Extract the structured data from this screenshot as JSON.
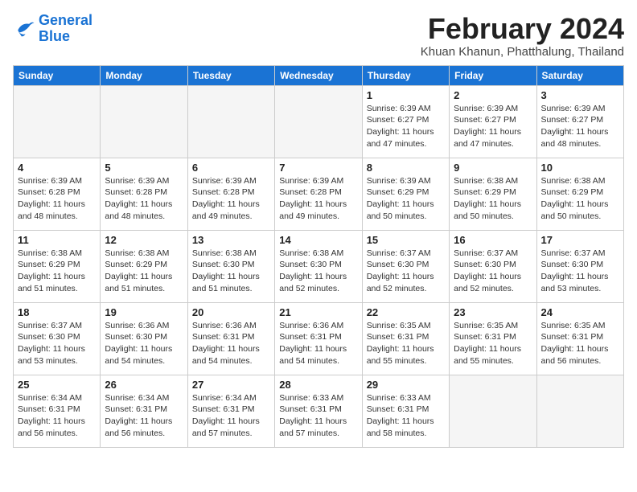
{
  "header": {
    "logo_line1": "General",
    "logo_line2": "Blue",
    "title": "February 2024",
    "subtitle": "Khuan Khanun, Phatthalung, Thailand"
  },
  "days_of_week": [
    "Sunday",
    "Monday",
    "Tuesday",
    "Wednesday",
    "Thursday",
    "Friday",
    "Saturday"
  ],
  "weeks": [
    [
      {
        "day": "",
        "info": ""
      },
      {
        "day": "",
        "info": ""
      },
      {
        "day": "",
        "info": ""
      },
      {
        "day": "",
        "info": ""
      },
      {
        "day": "1",
        "info": "Sunrise: 6:39 AM\nSunset: 6:27 PM\nDaylight: 11 hours\nand 47 minutes."
      },
      {
        "day": "2",
        "info": "Sunrise: 6:39 AM\nSunset: 6:27 PM\nDaylight: 11 hours\nand 47 minutes."
      },
      {
        "day": "3",
        "info": "Sunrise: 6:39 AM\nSunset: 6:27 PM\nDaylight: 11 hours\nand 48 minutes."
      }
    ],
    [
      {
        "day": "4",
        "info": "Sunrise: 6:39 AM\nSunset: 6:28 PM\nDaylight: 11 hours\nand 48 minutes."
      },
      {
        "day": "5",
        "info": "Sunrise: 6:39 AM\nSunset: 6:28 PM\nDaylight: 11 hours\nand 48 minutes."
      },
      {
        "day": "6",
        "info": "Sunrise: 6:39 AM\nSunset: 6:28 PM\nDaylight: 11 hours\nand 49 minutes."
      },
      {
        "day": "7",
        "info": "Sunrise: 6:39 AM\nSunset: 6:28 PM\nDaylight: 11 hours\nand 49 minutes."
      },
      {
        "day": "8",
        "info": "Sunrise: 6:39 AM\nSunset: 6:29 PM\nDaylight: 11 hours\nand 50 minutes."
      },
      {
        "day": "9",
        "info": "Sunrise: 6:38 AM\nSunset: 6:29 PM\nDaylight: 11 hours\nand 50 minutes."
      },
      {
        "day": "10",
        "info": "Sunrise: 6:38 AM\nSunset: 6:29 PM\nDaylight: 11 hours\nand 50 minutes."
      }
    ],
    [
      {
        "day": "11",
        "info": "Sunrise: 6:38 AM\nSunset: 6:29 PM\nDaylight: 11 hours\nand 51 minutes."
      },
      {
        "day": "12",
        "info": "Sunrise: 6:38 AM\nSunset: 6:29 PM\nDaylight: 11 hours\nand 51 minutes."
      },
      {
        "day": "13",
        "info": "Sunrise: 6:38 AM\nSunset: 6:30 PM\nDaylight: 11 hours\nand 51 minutes."
      },
      {
        "day": "14",
        "info": "Sunrise: 6:38 AM\nSunset: 6:30 PM\nDaylight: 11 hours\nand 52 minutes."
      },
      {
        "day": "15",
        "info": "Sunrise: 6:37 AM\nSunset: 6:30 PM\nDaylight: 11 hours\nand 52 minutes."
      },
      {
        "day": "16",
        "info": "Sunrise: 6:37 AM\nSunset: 6:30 PM\nDaylight: 11 hours\nand 52 minutes."
      },
      {
        "day": "17",
        "info": "Sunrise: 6:37 AM\nSunset: 6:30 PM\nDaylight: 11 hours\nand 53 minutes."
      }
    ],
    [
      {
        "day": "18",
        "info": "Sunrise: 6:37 AM\nSunset: 6:30 PM\nDaylight: 11 hours\nand 53 minutes."
      },
      {
        "day": "19",
        "info": "Sunrise: 6:36 AM\nSunset: 6:30 PM\nDaylight: 11 hours\nand 54 minutes."
      },
      {
        "day": "20",
        "info": "Sunrise: 6:36 AM\nSunset: 6:31 PM\nDaylight: 11 hours\nand 54 minutes."
      },
      {
        "day": "21",
        "info": "Sunrise: 6:36 AM\nSunset: 6:31 PM\nDaylight: 11 hours\nand 54 minutes."
      },
      {
        "day": "22",
        "info": "Sunrise: 6:35 AM\nSunset: 6:31 PM\nDaylight: 11 hours\nand 55 minutes."
      },
      {
        "day": "23",
        "info": "Sunrise: 6:35 AM\nSunset: 6:31 PM\nDaylight: 11 hours\nand 55 minutes."
      },
      {
        "day": "24",
        "info": "Sunrise: 6:35 AM\nSunset: 6:31 PM\nDaylight: 11 hours\nand 56 minutes."
      }
    ],
    [
      {
        "day": "25",
        "info": "Sunrise: 6:34 AM\nSunset: 6:31 PM\nDaylight: 11 hours\nand 56 minutes."
      },
      {
        "day": "26",
        "info": "Sunrise: 6:34 AM\nSunset: 6:31 PM\nDaylight: 11 hours\nand 56 minutes."
      },
      {
        "day": "27",
        "info": "Sunrise: 6:34 AM\nSunset: 6:31 PM\nDaylight: 11 hours\nand 57 minutes."
      },
      {
        "day": "28",
        "info": "Sunrise: 6:33 AM\nSunset: 6:31 PM\nDaylight: 11 hours\nand 57 minutes."
      },
      {
        "day": "29",
        "info": "Sunrise: 6:33 AM\nSunset: 6:31 PM\nDaylight: 11 hours\nand 58 minutes."
      },
      {
        "day": "",
        "info": ""
      },
      {
        "day": "",
        "info": ""
      }
    ]
  ]
}
